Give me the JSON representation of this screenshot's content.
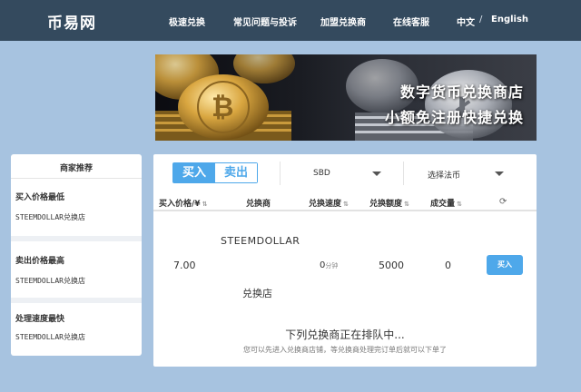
{
  "header": {
    "logo": "币易网",
    "nav": [
      "极速兑换",
      "常见问题与投诉",
      "加盟兑换商",
      "在线客服"
    ],
    "lang_cn": "中文",
    "lang_sep": "/",
    "lang_en": "English"
  },
  "banner": {
    "line1": "数字货币兑换商店",
    "line2": "小额免注册快捷兑换"
  },
  "sidebar": {
    "title": "商家推荐",
    "sections": [
      {
        "title": "买入价格最低",
        "store": "STEEMDOLLAR兑换店"
      },
      {
        "title": "卖出价格最高",
        "store": "STEEMDOLLAR兑换店"
      },
      {
        "title": "处理速度最快",
        "store": "STEEMDOLLAR兑换店"
      }
    ]
  },
  "main": {
    "toggle_buy": "买入",
    "toggle_sell": "卖出",
    "coin_select": "SBD",
    "fiat_select": "选择法币",
    "columns": [
      "买入价格/¥",
      "兑换商",
      "兑换速度",
      "兑换额度",
      "成交量"
    ],
    "row": {
      "merchant_line1": "STEEMDOLLAR",
      "merchant_line2": "兑换店",
      "price": "7.00",
      "speed": "0",
      "speed_unit": "分钟",
      "amount": "5000",
      "volume": "0",
      "buy_label": "买入"
    },
    "queue_title": "下列兑换商正在排队中...",
    "queue_subtitle": "您可以先进入兑换商店铺，等兑换商处理完订单后就可以下单了"
  },
  "colors": {
    "header_bg": "#344a5e",
    "page_bg": "#a7c3e0",
    "accent": "#4ea8ea"
  }
}
